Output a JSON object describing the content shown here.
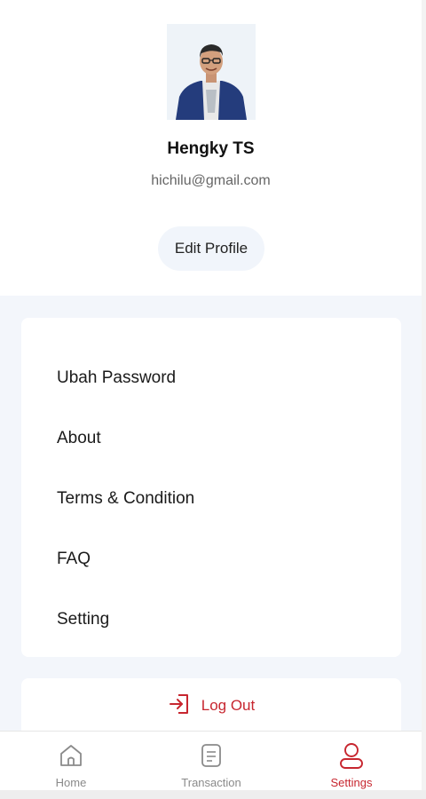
{
  "profile": {
    "name": "Hengky TS",
    "email": "hichilu@gmail.com",
    "edit_label": "Edit Profile"
  },
  "menu": {
    "items": [
      {
        "label": "Ubah Password"
      },
      {
        "label": "About"
      },
      {
        "label": "Terms & Condition"
      },
      {
        "label": "FAQ"
      },
      {
        "label": "Setting"
      }
    ]
  },
  "logout": {
    "label": "Log Out",
    "icon": "logout-icon"
  },
  "nav": {
    "items": [
      {
        "label": "Home",
        "icon": "home-icon",
        "active": false
      },
      {
        "label": "Transaction",
        "icon": "document-icon",
        "active": false
      },
      {
        "label": "Settings",
        "icon": "user-icon",
        "active": true
      }
    ]
  },
  "colors": {
    "accent": "#c7262f",
    "background": "#f3f6fb",
    "muted": "#8a8a8a"
  }
}
